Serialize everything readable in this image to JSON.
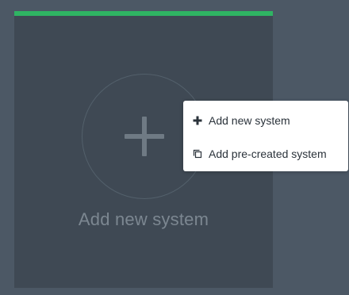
{
  "card": {
    "title": "Add new system",
    "icon": "plus-icon",
    "accent": "#2fb463"
  },
  "menu": {
    "items": [
      {
        "label": "Add new system",
        "icon": "plus-icon"
      },
      {
        "label": "Add pre-created system",
        "icon": "copy-icon"
      }
    ]
  }
}
